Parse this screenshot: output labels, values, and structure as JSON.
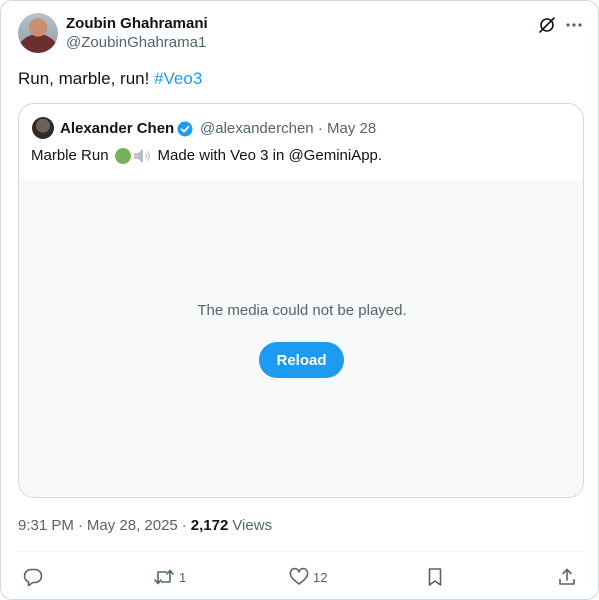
{
  "author": {
    "name": "Zoubin Ghahramani",
    "handle": "@ZoubinGhahrama1"
  },
  "header_icons": [
    "grok-icon",
    "more-icon"
  ],
  "tweet": {
    "text": "Run, marble, run! ",
    "hashtag": "#Veo3"
  },
  "quote": {
    "author_name": "Alexander Chen",
    "verified": true,
    "handle": "@alexanderchen",
    "separator": "·",
    "date": "May 28",
    "text_before": "Marble Run",
    "text_after": "Made with Veo 3 in @GeminiApp.",
    "emojis": [
      "green-circle",
      "speaker-icon"
    ],
    "media": {
      "message": "The media could not be played.",
      "reload_label": "Reload"
    }
  },
  "meta": {
    "time": "9:31 PM",
    "separator": "·",
    "date": "May 28, 2025",
    "separator2": "·",
    "views_count": "2,172",
    "views_label": "Views"
  },
  "actions": {
    "reply_count": "",
    "retweet_count": "1",
    "like_count": "12"
  },
  "colors": {
    "accent": "#1d9bf0",
    "secondary_text": "#536471",
    "border": "#cfd9de",
    "media_bg": "#f7f9f9"
  }
}
